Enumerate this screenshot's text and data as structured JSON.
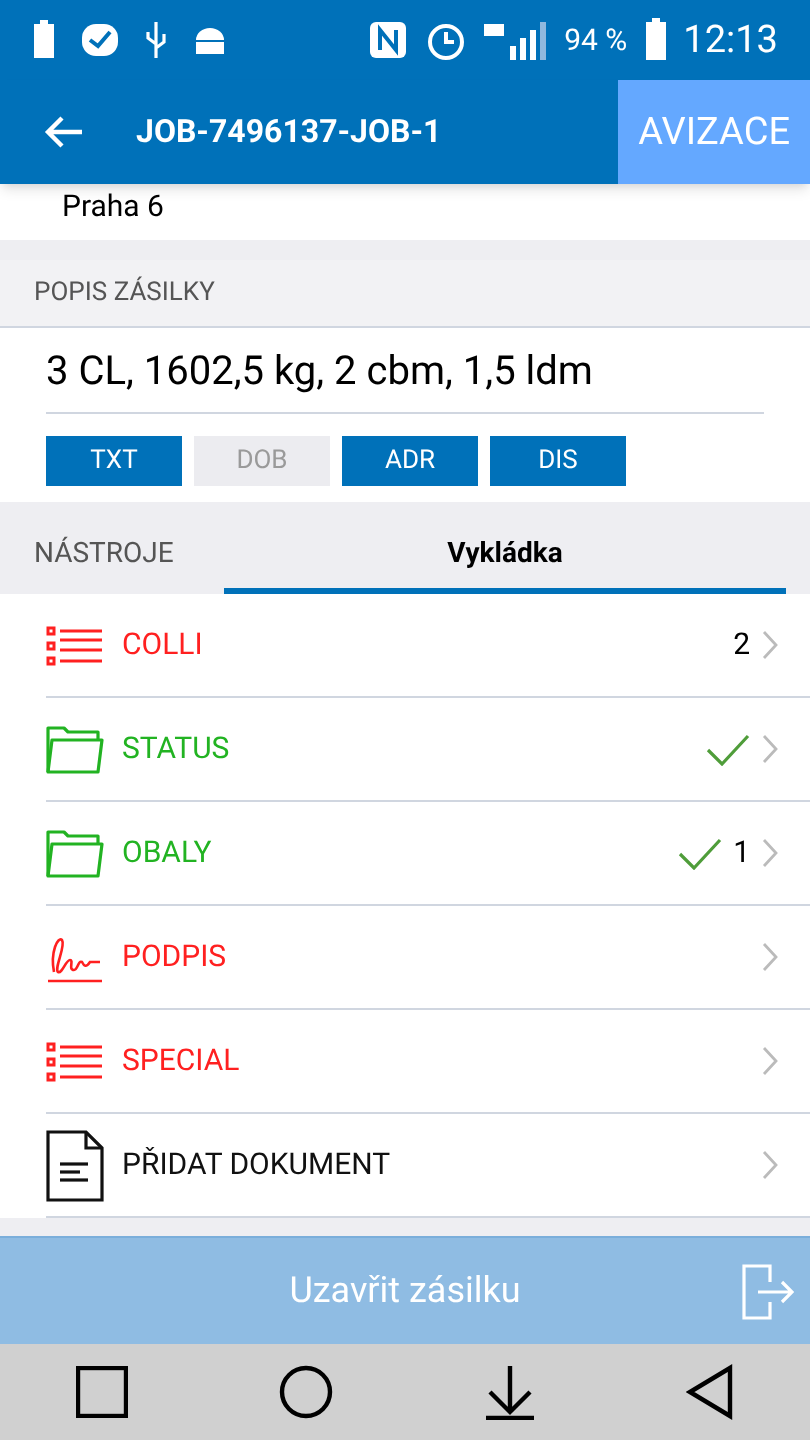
{
  "status_bar": {
    "battery": "94 %",
    "time": "12:13"
  },
  "app_bar": {
    "title": "JOB-7496137-JOB-1",
    "action": "AVIZACE"
  },
  "address": {
    "line": "Praha 6"
  },
  "description": {
    "heading": "POPIS ZÁSILKY",
    "value": "3 CL, 1602,5 kg, 2 cbm, 1,5 ldm"
  },
  "tags": [
    {
      "label": "TXT",
      "disabled": false
    },
    {
      "label": "DOB",
      "disabled": true
    },
    {
      "label": "ADR",
      "disabled": false
    },
    {
      "label": "DIS",
      "disabled": false
    }
  ],
  "tabs": [
    {
      "label": "NÁSTROJE",
      "selected": false
    },
    {
      "label": "Vykládka",
      "selected": true
    }
  ],
  "items": [
    {
      "kind": "list",
      "label": "COLLI",
      "color": "#ff2020",
      "checked": false,
      "count": "2"
    },
    {
      "kind": "folder",
      "label": "STATUS",
      "color": "#22b322",
      "checked": true
    },
    {
      "kind": "folder",
      "label": "OBALY",
      "color": "#22b322",
      "checked": true,
      "count": "1"
    },
    {
      "kind": "signature",
      "label": "PODPIS",
      "color": "#ff2020",
      "checked": false
    },
    {
      "kind": "list",
      "label": "SPECIAL",
      "color": "#ff2020",
      "checked": false
    },
    {
      "kind": "document",
      "label": "PŘIDAT DOKUMENT",
      "color": "#111111",
      "checked": false
    }
  ],
  "footer": {
    "button": "Uzavřit zásilku"
  }
}
